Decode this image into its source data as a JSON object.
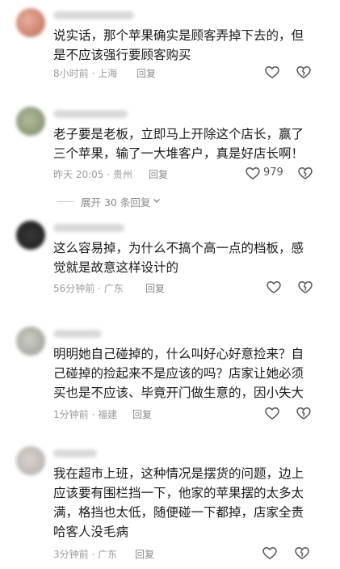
{
  "comments": [
    {
      "text": "说实话，那个苹果确实是顾客弄掉下去的，但是不应该强行要顾客购买",
      "meta": "8小时前 · 上海",
      "reply": "回复",
      "likes": ""
    },
    {
      "text": "老子要是老板，立即马上开除这个店长，赢了三个苹果，输了一大堆客户，真是好店长啊！",
      "meta": "昨天 20:05 · 贵州",
      "reply": "回复",
      "likes": "979"
    },
    {
      "text": "这么容易掉，为什么不搞个高一点的档板，感觉就是故意这样设计的",
      "meta": "56分钟前 · 广东",
      "reply": "回复",
      "likes": ""
    },
    {
      "text": "明明她自己碰掉的，什么叫好心好意捡来？自己碰掉的捡起来不是应该的吗？店家让她必须买也是不应该、毕竟开门做生意的，因小失大",
      "meta": "1分钟前 · 福建",
      "reply": "回复",
      "likes": ""
    },
    {
      "text": "我在超市上班，这种情况是摆货的问题，边上应该要有围栏挡一下，他家的苹果摆的太多太满，格挡也太低，随便碰一下都掉，店家全责哈客人没毛病",
      "meta": "3分钟前 · 广东",
      "reply": "回复",
      "likes": ""
    }
  ],
  "expand_replies": "展开 30 条回复",
  "icons": {
    "like": "heart-outline-icon",
    "dislike": "broken-heart-icon",
    "expand": "chevron-down-icon"
  },
  "colors": {
    "text": "#1a1a1a",
    "meta": "#9b9b9b",
    "icon": "#555555"
  }
}
